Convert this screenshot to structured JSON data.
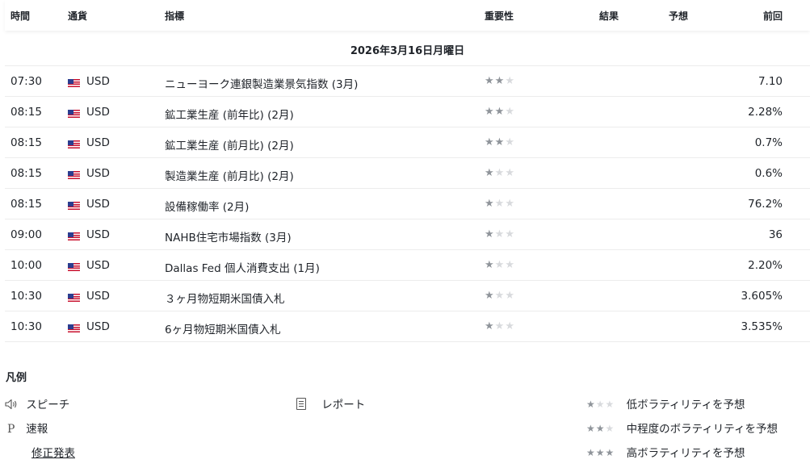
{
  "table": {
    "headers": {
      "time": "時間",
      "currency": "通貨",
      "indicator": "指標",
      "importance": "重要性",
      "actual": "結果",
      "forecast": "予想",
      "previous": "前回"
    },
    "date": "2026年3月16日月曜日",
    "rows": [
      {
        "time": "07:30",
        "currency": "USD",
        "indicator": "ニューヨーク連銀製造業景気指数 (3月)",
        "importance": 2,
        "actual": "",
        "forecast": "",
        "previous": "7.10"
      },
      {
        "time": "08:15",
        "currency": "USD",
        "indicator": "鉱工業生産 (前年比) (2月)",
        "importance": 2,
        "actual": "",
        "forecast": "",
        "previous": "2.28%"
      },
      {
        "time": "08:15",
        "currency": "USD",
        "indicator": "鉱工業生産 (前月比) (2月)",
        "importance": 2,
        "actual": "",
        "forecast": "",
        "previous": "0.7%"
      },
      {
        "time": "08:15",
        "currency": "USD",
        "indicator": "製造業生産 (前月比) (2月)",
        "importance": 1,
        "actual": "",
        "forecast": "",
        "previous": "0.6%"
      },
      {
        "time": "08:15",
        "currency": "USD",
        "indicator": "設備稼働率 (2月)",
        "importance": 1,
        "actual": "",
        "forecast": "",
        "previous": "76.2%"
      },
      {
        "time": "09:00",
        "currency": "USD",
        "indicator": "NAHB住宅市場指数 (3月)",
        "importance": 1,
        "actual": "",
        "forecast": "",
        "previous": "36"
      },
      {
        "time": "10:00",
        "currency": "USD",
        "indicator": "Dallas Fed 個人消費支出 (1月)",
        "importance": 1,
        "actual": "",
        "forecast": "",
        "previous": "2.20%"
      },
      {
        "time": "10:30",
        "currency": "USD",
        "indicator": "３ヶ月物短期米国債入札",
        "importance": 1,
        "actual": "",
        "forecast": "",
        "previous": "3.605%"
      },
      {
        "time": "10:30",
        "currency": "USD",
        "indicator": "6ヶ月物短期米国債入札",
        "importance": 1,
        "actual": "",
        "forecast": "",
        "previous": "3.535%"
      }
    ]
  },
  "legend": {
    "title": "凡例",
    "speech": {
      "icon": "speaker-icon",
      "label": "スピーチ"
    },
    "preliminary": {
      "icon_text": "P",
      "label": "速報"
    },
    "revised": {
      "label": "修正発表"
    },
    "report": {
      "icon": "document-icon",
      "label": "レポート"
    },
    "low": {
      "stars": 1,
      "label": "低ボラティリティを予想"
    },
    "medium": {
      "stars": 2,
      "label": "中程度のボラティリティを予想"
    },
    "high": {
      "stars": 3,
      "label": "高ボラティリティを予想"
    }
  },
  "colors": {
    "star_active": "#8f949a",
    "star_inactive": "#d8dadd",
    "divider": "#ececec"
  }
}
